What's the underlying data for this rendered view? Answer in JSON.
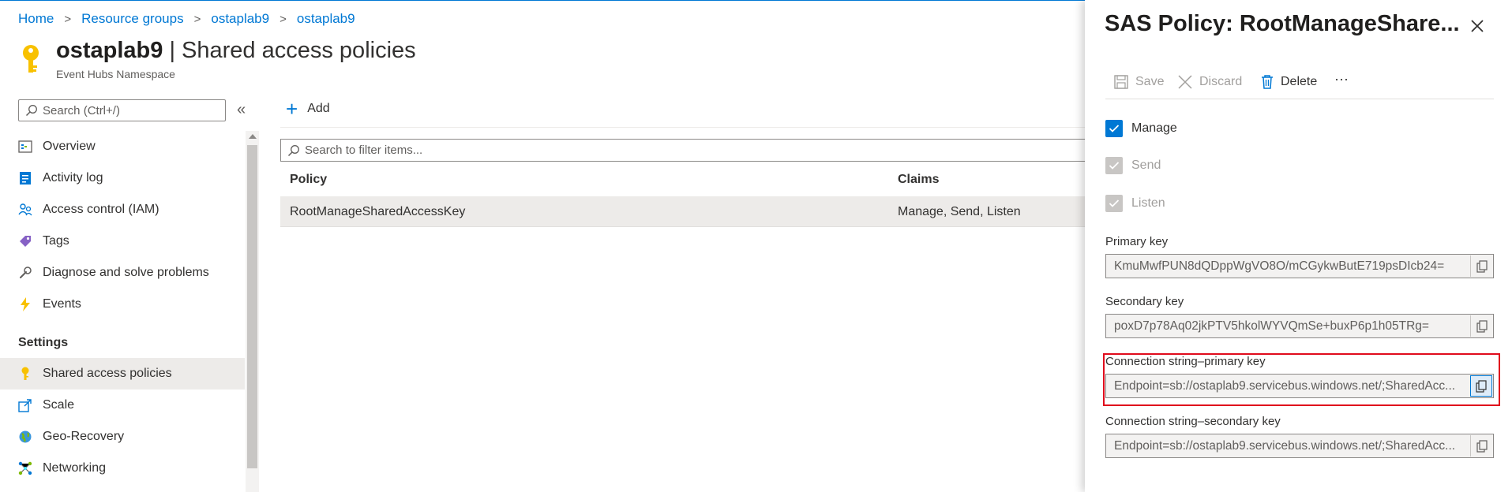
{
  "breadcrumb": {
    "items": [
      "Home",
      "Resource groups",
      "ostaplab9",
      "ostaplab9"
    ],
    "separator": ">"
  },
  "header": {
    "resource_name": "ostaplab9",
    "divider": "|",
    "page_name": "Shared access policies",
    "subtitle": "Event Hubs Namespace",
    "icon": "key-icon"
  },
  "sidebar": {
    "search_placeholder": "Search (Ctrl+/)",
    "collapse_glyph": "«",
    "items": [
      {
        "label": "Overview",
        "icon": "overview-icon"
      },
      {
        "label": "Activity log",
        "icon": "activity-log-icon"
      },
      {
        "label": "Access control (IAM)",
        "icon": "iam-icon"
      },
      {
        "label": "Tags",
        "icon": "tag-icon"
      },
      {
        "label": "Diagnose and solve problems",
        "icon": "wrench-icon"
      },
      {
        "label": "Events",
        "icon": "lightning-icon"
      }
    ],
    "settings_heading": "Settings",
    "settings_items": [
      {
        "label": "Shared access policies",
        "icon": "key-icon",
        "active": true
      },
      {
        "label": "Scale",
        "icon": "scale-icon"
      },
      {
        "label": "Geo-Recovery",
        "icon": "globe-icon"
      },
      {
        "label": "Networking",
        "icon": "network-icon"
      }
    ]
  },
  "main": {
    "add_label": "Add",
    "filter_placeholder": "Search to filter items...",
    "columns": [
      "Policy",
      "Claims"
    ],
    "rows": [
      {
        "policy": "RootManageSharedAccessKey",
        "claims": "Manage, Send, Listen"
      }
    ]
  },
  "panel": {
    "title": "SAS Policy: RootManageShare...",
    "toolbar": {
      "save": "Save",
      "discard": "Discard",
      "delete": "Delete",
      "more": "···"
    },
    "checkboxes": [
      {
        "label": "Manage",
        "checked": true,
        "disabled": false
      },
      {
        "label": "Send",
        "checked": true,
        "disabled": true
      },
      {
        "label": "Listen",
        "checked": true,
        "disabled": true
      }
    ],
    "fields": [
      {
        "label": "Primary key",
        "value": "KmuMwfPUN8dQDppWgVO8O/mCGykwButE719psDIcb24="
      },
      {
        "label": "Secondary key",
        "value": "poxD7p78Aq02jkPTV5hkolWYVQmSe+buxP6p1h05TRg="
      },
      {
        "label": "Connection string–primary key",
        "value": "Endpoint=sb://ostaplab9.servicebus.windows.net/;SharedAcc..."
      },
      {
        "label": "Connection string–secondary key",
        "value": "Endpoint=sb://ostaplab9.servicebus.windows.net/;SharedAcc..."
      }
    ]
  },
  "colors": {
    "accent": "#0078d4",
    "highlight_border": "#e00b1c",
    "active_row": "#edebe9"
  }
}
